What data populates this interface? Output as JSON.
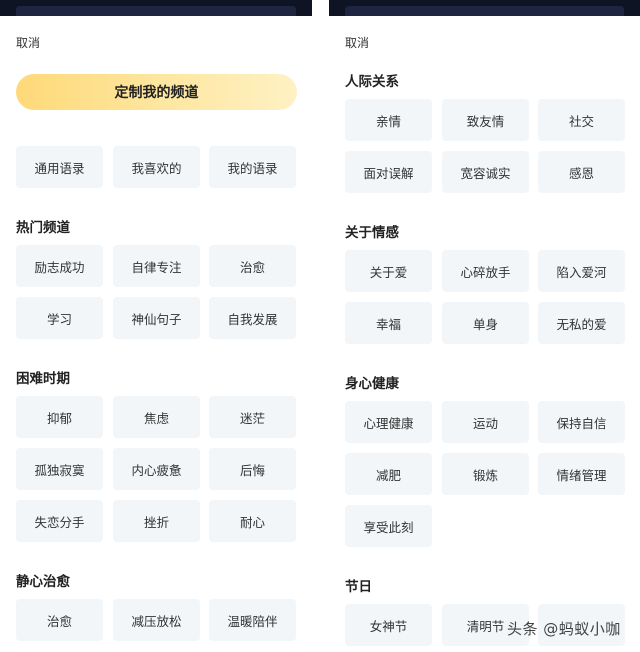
{
  "left": {
    "cancel": "取消",
    "customize": "定制我的频道",
    "quick": [
      "通用语录",
      "我喜欢的",
      "我的语录"
    ],
    "sections": [
      {
        "title": "热门频道",
        "items": [
          "励志成功",
          "自律专注",
          "治愈",
          "学习",
          "神仙句子",
          "自我发展"
        ]
      },
      {
        "title": "困难时期",
        "items": [
          "抑郁",
          "焦虑",
          "迷茫",
          "孤独寂寞",
          "内心疲惫",
          "后悔",
          "失恋分手",
          "挫折",
          "耐心"
        ]
      },
      {
        "title": "静心治愈",
        "items": [
          "治愈",
          "减压放松",
          "温暖陪伴"
        ]
      }
    ]
  },
  "right": {
    "cancel": "取消",
    "sections": [
      {
        "title": "人际关系",
        "items": [
          "亲情",
          "致友情",
          "社交",
          "面对误解",
          "宽容诚实",
          "感恩"
        ]
      },
      {
        "title": "关于情感",
        "items": [
          "关于爱",
          "心碎放手",
          "陷入爱河",
          "幸福",
          "单身",
          "无私的爱"
        ]
      },
      {
        "title": "身心健康",
        "items": [
          "心理健康",
          "运动",
          "保持自信",
          "减肥",
          "锻炼",
          "情绪管理",
          "享受此刻"
        ]
      },
      {
        "title": "节日",
        "items": [
          "女神节",
          "清明节",
          ""
        ]
      }
    ]
  },
  "watermark": "头条 @蚂蚁小咖"
}
